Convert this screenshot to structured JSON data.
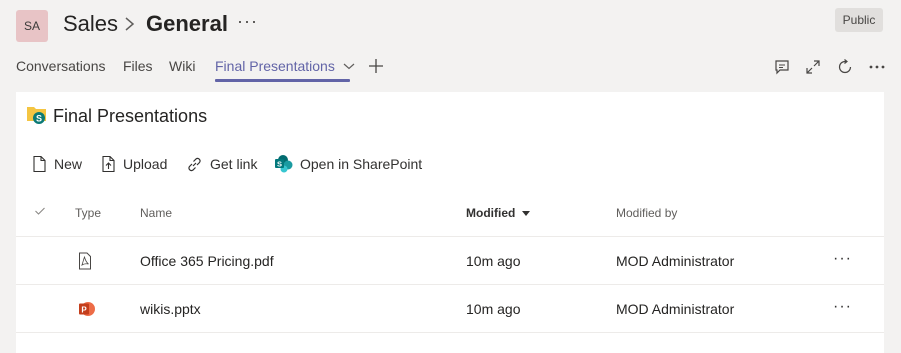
{
  "header": {
    "avatar_initials": "SA",
    "team": "Sales",
    "separator": ">",
    "channel": "General",
    "more": "···",
    "badge": "Public"
  },
  "tabs": [
    {
      "label": "Conversations",
      "active": false
    },
    {
      "label": "Files",
      "active": false
    },
    {
      "label": "Wiki",
      "active": false
    },
    {
      "label": "Final Presentations",
      "active": true
    }
  ],
  "header_icons": [
    "conversation-icon",
    "expand-icon",
    "refresh-icon",
    "more-icon"
  ],
  "accent_color": "#6264a7",
  "library": {
    "title": "Final Presentations",
    "commands": [
      {
        "label": "New",
        "icon": "new-document-icon"
      },
      {
        "label": "Upload",
        "icon": "upload-icon"
      },
      {
        "label": "Get link",
        "icon": "link-icon"
      },
      {
        "label": "Open in SharePoint",
        "icon": "sharepoint-icon"
      }
    ],
    "columns": {
      "type": "Type",
      "name": "Name",
      "modified": "Modified",
      "modified_by": "Modified by"
    },
    "sort": {
      "column": "modified",
      "direction": "descending"
    },
    "files": [
      {
        "icon": "pdf-file-icon",
        "name": "Office 365 Pricing.pdf",
        "modified": "10m ago",
        "modified_by": "MOD Administrator"
      },
      {
        "icon": "pptx-file-icon",
        "name": "wikis.pptx",
        "modified": "10m ago",
        "modified_by": "MOD Administrator"
      }
    ],
    "row_more": "···"
  }
}
